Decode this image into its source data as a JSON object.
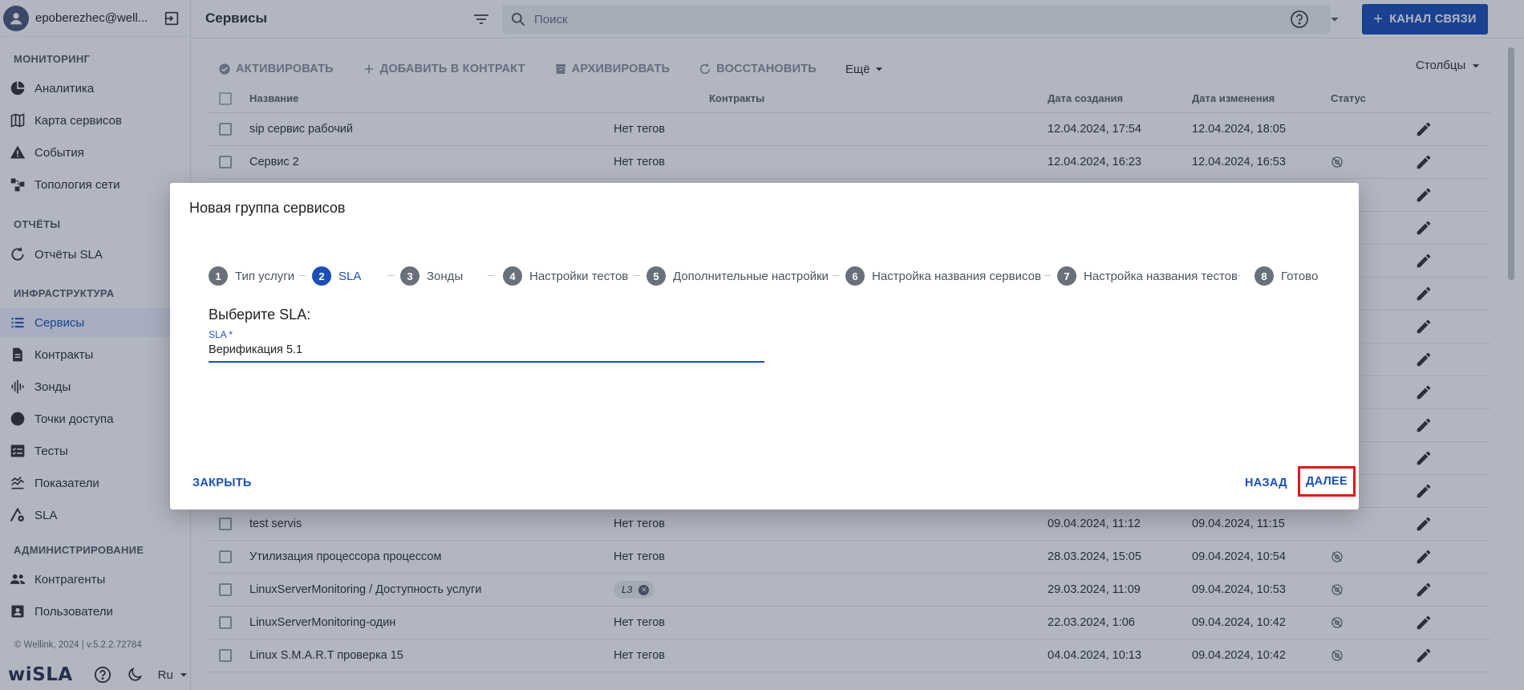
{
  "user": {
    "email": "epoberezhec@well..."
  },
  "sidebar": {
    "sections": {
      "monitoring": "МОНИТОРИНГ",
      "reports": "ОТЧЁТЫ",
      "infrastructure": "ИНФРАСТРУКТУРА",
      "administration": "АДМИНИСТРИРОВАНИЕ"
    },
    "items": {
      "analytics": "Аналитика",
      "service_map": "Карта сервисов",
      "events": "События",
      "topology": "Топология сети",
      "sla_reports": "Отчёты SLA",
      "services": "Сервисы",
      "contracts": "Контракты",
      "probes": "Зонды",
      "access_points": "Точки доступа",
      "tests": "Тесты",
      "metrics": "Показатели",
      "sla": "SLA",
      "counterparties": "Контрагенты",
      "users": "Пользователи"
    },
    "copyright": "© Wellink, 2024 | v.5.2.2.72784",
    "logo": "wiSLA",
    "language": "Ru"
  },
  "header": {
    "title": "Сервисы",
    "search_placeholder": "Поиск",
    "channel_button": "КАНАЛ СВЯЗИ"
  },
  "toolbar": {
    "activate": "АКТИВИРОВАТЬ",
    "add_to_contract": "ДОБАВИТЬ В КОНТРАКТ",
    "archive": "АРХИВИРОВАТЬ",
    "restore": "ВОССТАНОВИТЬ",
    "more": "Ещё",
    "columns": "Столбцы"
  },
  "table": {
    "columns": {
      "name": "Название",
      "contracts": "Контракты",
      "created": "Дата создания",
      "changed": "Дата изменения",
      "status": "Статус"
    },
    "rows": [
      {
        "name": "sip сервис рабочий",
        "contracts": "Нет тегов",
        "created": "12.04.2024, 17:54",
        "changed": "12.04.2024, 18:05",
        "status": "blue"
      },
      {
        "name": "Сервис 2",
        "contracts": "Нет тегов",
        "created": "12.04.2024, 16:23",
        "changed": "12.04.2024, 16:53",
        "status": "disabled"
      },
      {
        "name": "",
        "contracts": "",
        "created": "",
        "changed": "",
        "status": ""
      },
      {
        "name": "",
        "contracts": "",
        "created": "",
        "changed": "",
        "status": ""
      },
      {
        "name": "",
        "contracts": "",
        "created": "",
        "changed": "",
        "status": ""
      },
      {
        "name": "",
        "contracts": "",
        "created": "",
        "changed": "",
        "status": ""
      },
      {
        "name": "",
        "contracts": "",
        "created": "",
        "changed": "",
        "status": ""
      },
      {
        "name": "",
        "contracts": "",
        "created": "",
        "changed": "",
        "status": ""
      },
      {
        "name": "",
        "contracts": "",
        "created": "",
        "changed": "",
        "status": ""
      },
      {
        "name": "",
        "contracts": "",
        "created": "",
        "changed": "",
        "status": ""
      },
      {
        "name": "",
        "contracts": "",
        "created": "",
        "changed": "",
        "status": ""
      },
      {
        "name": "",
        "contracts": "",
        "created": "",
        "changed": "",
        "status": ""
      },
      {
        "name": "test servis",
        "contracts": "Нет тегов",
        "created": "09.04.2024, 11:12",
        "changed": "09.04.2024, 11:15",
        "status": "yellow"
      },
      {
        "name": "Утилизация процессора процессом",
        "contracts": "Нет тегов",
        "created": "28.03.2024, 15:05",
        "changed": "09.04.2024, 10:54",
        "status": "disabled"
      },
      {
        "name": "LinuxServerMonitoring / Доступность услуги",
        "contracts": "",
        "tag": "L3",
        "created": "29.03.2024, 11:09",
        "changed": "09.04.2024, 10:53",
        "status": "disabled"
      },
      {
        "name": "LinuxServerMonitoring-один",
        "contracts": "Нет тегов",
        "created": "22.03.2024, 1:06",
        "changed": "09.04.2024, 10:42",
        "status": "disabled"
      },
      {
        "name": "Linux S.M.A.R.T проверка 15",
        "contracts": "Нет тегов",
        "created": "04.04.2024, 10:13",
        "changed": "09.04.2024, 10:42",
        "status": "disabled"
      }
    ]
  },
  "modal": {
    "title": "Новая группа сервисов",
    "steps": [
      {
        "num": "1",
        "label": "Тип услуги"
      },
      {
        "num": "2",
        "label": "SLA"
      },
      {
        "num": "3",
        "label": "Зонды"
      },
      {
        "num": "4",
        "label": "Настройки тестов"
      },
      {
        "num": "5",
        "label": "Дополнительные настройки"
      },
      {
        "num": "6",
        "label": "Настройка названия сервисов"
      },
      {
        "num": "7",
        "label": "Настройка названия тестов"
      },
      {
        "num": "8",
        "label": "Готово"
      }
    ],
    "heading": "Выберите SLA:",
    "sla_label": "SLA *",
    "sla_value": "Верификация 5.1",
    "close_button": "ЗАКРЫТЬ",
    "back_button": "НАЗАД",
    "next_button": "ДАЛЕЕ"
  },
  "colors": {
    "accent": "#1a4fb8",
    "status_blue": "#1a4fb8",
    "status_yellow": "#d8a31a",
    "highlight": "#e01818"
  }
}
